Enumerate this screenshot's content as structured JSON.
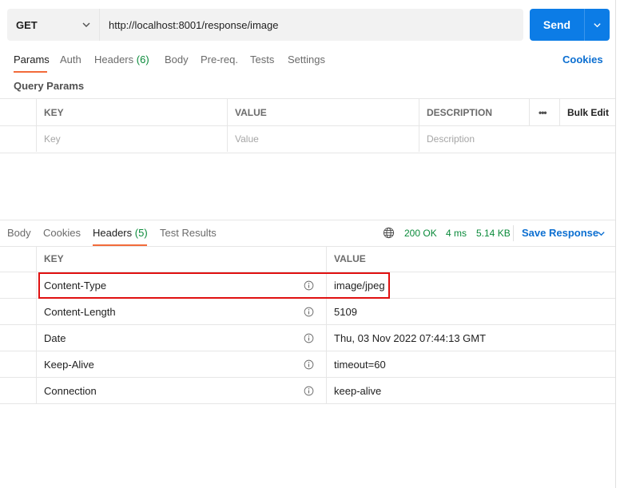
{
  "request": {
    "method": "GET",
    "url": "http://localhost:8001/response/image",
    "send_label": "Send"
  },
  "request_tabs": {
    "items": [
      {
        "label": "Params"
      },
      {
        "label": "Auth"
      },
      {
        "label": "Headers",
        "count": "(6)"
      },
      {
        "label": "Body"
      },
      {
        "label": "Pre-req."
      },
      {
        "label": "Tests"
      },
      {
        "label": "Settings"
      }
    ],
    "cookies": "Cookies"
  },
  "query_params": {
    "title": "Query Params",
    "columns": {
      "key": "KEY",
      "value": "VALUE",
      "description": "DESCRIPTION"
    },
    "placeholders": {
      "key": "Key",
      "value": "Value",
      "description": "Description"
    },
    "more_label": "•••",
    "bulk_edit": "Bulk Edit"
  },
  "response_tabs": {
    "items": [
      {
        "label": "Body"
      },
      {
        "label": "Cookies"
      },
      {
        "label": "Headers",
        "count": "(5)"
      },
      {
        "label": "Test Results"
      }
    ]
  },
  "response_meta": {
    "status": "200 OK",
    "time": "4 ms",
    "size": "5.14 KB",
    "save_label": "Save Response"
  },
  "response_headers": {
    "columns": {
      "key": "KEY",
      "value": "VALUE"
    },
    "rows": [
      {
        "key": "Content-Type",
        "value": "image/jpeg"
      },
      {
        "key": "Content-Length",
        "value": "5109"
      },
      {
        "key": "Date",
        "value": "Thu, 03 Nov 2022 07:44:13 GMT"
      },
      {
        "key": "Keep-Alive",
        "value": "timeout=60"
      },
      {
        "key": "Connection",
        "value": "keep-alive"
      }
    ]
  },
  "colors": {
    "accent": "#0c7ce6",
    "active_tab_underline": "#f26b3a",
    "status_ok": "#0a8a3a",
    "highlight_box": "#e01010"
  }
}
